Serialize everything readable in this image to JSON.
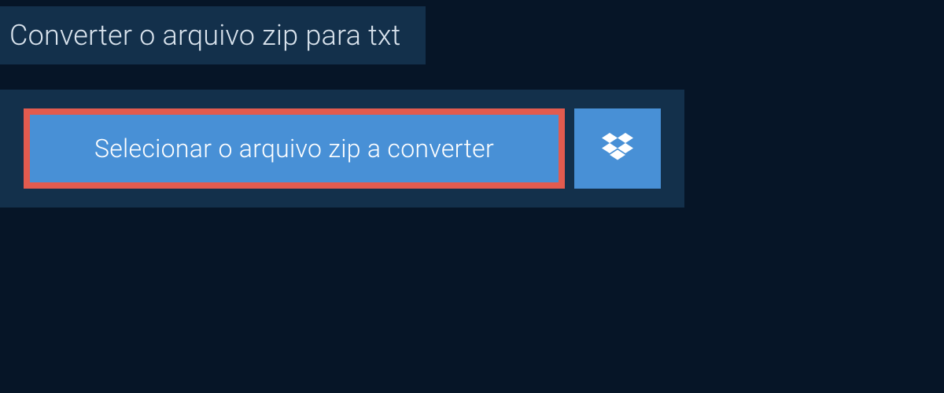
{
  "title": "Converter o arquivo zip para txt",
  "actions": {
    "select_file_label": "Selecionar o arquivo zip a converter"
  },
  "colors": {
    "background": "#061527",
    "panel": "#13304b",
    "button": "#4890d6",
    "highlight_border": "#e25b4f",
    "text_light": "#d9e3ed",
    "text_white": "#ffffff"
  }
}
